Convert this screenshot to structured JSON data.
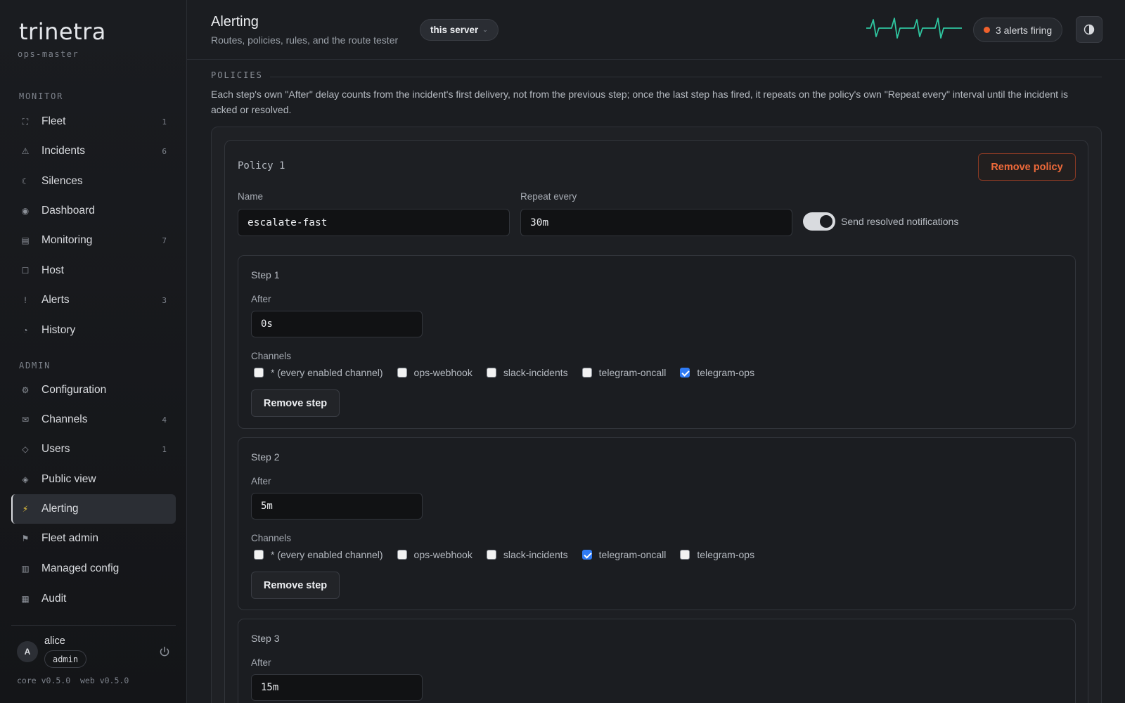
{
  "brand": {
    "name": "trinetra",
    "instance": "ops-master"
  },
  "sidebar": {
    "monitor_label": "MONITOR",
    "admin_label": "ADMIN",
    "monitor_items": [
      {
        "label": "Fleet",
        "count": "1",
        "icon": "fleet-icon"
      },
      {
        "label": "Incidents",
        "count": "6",
        "icon": "warning-icon"
      },
      {
        "label": "Silences",
        "count": "",
        "icon": "moon-icon"
      },
      {
        "label": "Dashboard",
        "count": "",
        "icon": "dashboard-icon"
      },
      {
        "label": "Monitoring",
        "count": "7",
        "icon": "monitoring-icon"
      },
      {
        "label": "Host",
        "count": "",
        "icon": "host-icon"
      },
      {
        "label": "Alerts",
        "count": "3",
        "icon": "exclamation-icon"
      },
      {
        "label": "History",
        "count": "",
        "icon": "history-icon"
      }
    ],
    "admin_items": [
      {
        "label": "Configuration",
        "count": "",
        "icon": "gear-icon"
      },
      {
        "label": "Channels",
        "count": "4",
        "icon": "envelope-icon"
      },
      {
        "label": "Users",
        "count": "1",
        "icon": "users-icon"
      },
      {
        "label": "Public view",
        "count": "",
        "icon": "public-view-icon"
      },
      {
        "label": "Alerting",
        "count": "",
        "icon": "lightning-icon",
        "active": true
      },
      {
        "label": "Fleet admin",
        "count": "",
        "icon": "flag-icon"
      },
      {
        "label": "Managed config",
        "count": "",
        "icon": "managed-config-icon"
      },
      {
        "label": "Audit",
        "count": "",
        "icon": "audit-icon"
      }
    ],
    "user": {
      "initial": "A",
      "name": "alice",
      "role": "admin"
    },
    "version": "core v0.5.0  web v0.5.0"
  },
  "header": {
    "title": "Alerting",
    "subtitle": "Routes, policies, rules, and the route tester",
    "server_select": "this server",
    "alerts_status": "3 alerts firing"
  },
  "colors": {
    "accent_alert": "#f0612c",
    "pulse_line": "#2fc6a0",
    "checkbox_checked": "#2f7bf5",
    "danger_text": "#ef6a3a"
  },
  "policies": {
    "section_label": "POLICIES",
    "description": "Each step's own \"After\" delay counts from the incident's first delivery, not from the previous step; once the last step has fired, it repeats on the policy's own \"Repeat every\" interval until the incident is acked or resolved.",
    "policy": {
      "title": "Policy 1",
      "remove_label": "Remove policy",
      "name_label": "Name",
      "name_value": "escalate-fast",
      "repeat_label": "Repeat every",
      "repeat_value": "30m",
      "send_resolved_label": "Send resolved notifications",
      "send_resolved": true,
      "after_label": "After",
      "channels_label": "Channels",
      "remove_step_label": "Remove step",
      "steps": [
        {
          "title": "Step 1",
          "after": "0s",
          "channels": [
            {
              "label": "* (every enabled channel)",
              "checked": false
            },
            {
              "label": "ops-webhook",
              "checked": false
            },
            {
              "label": "slack-incidents",
              "checked": false
            },
            {
              "label": "telegram-oncall",
              "checked": false
            },
            {
              "label": "telegram-ops",
              "checked": true
            }
          ]
        },
        {
          "title": "Step 2",
          "after": "5m",
          "channels": [
            {
              "label": "* (every enabled channel)",
              "checked": false
            },
            {
              "label": "ops-webhook",
              "checked": false
            },
            {
              "label": "slack-incidents",
              "checked": false
            },
            {
              "label": "telegram-oncall",
              "checked": true
            },
            {
              "label": "telegram-ops",
              "checked": false
            }
          ]
        },
        {
          "title": "Step 3",
          "after": "15m"
        }
      ]
    }
  }
}
